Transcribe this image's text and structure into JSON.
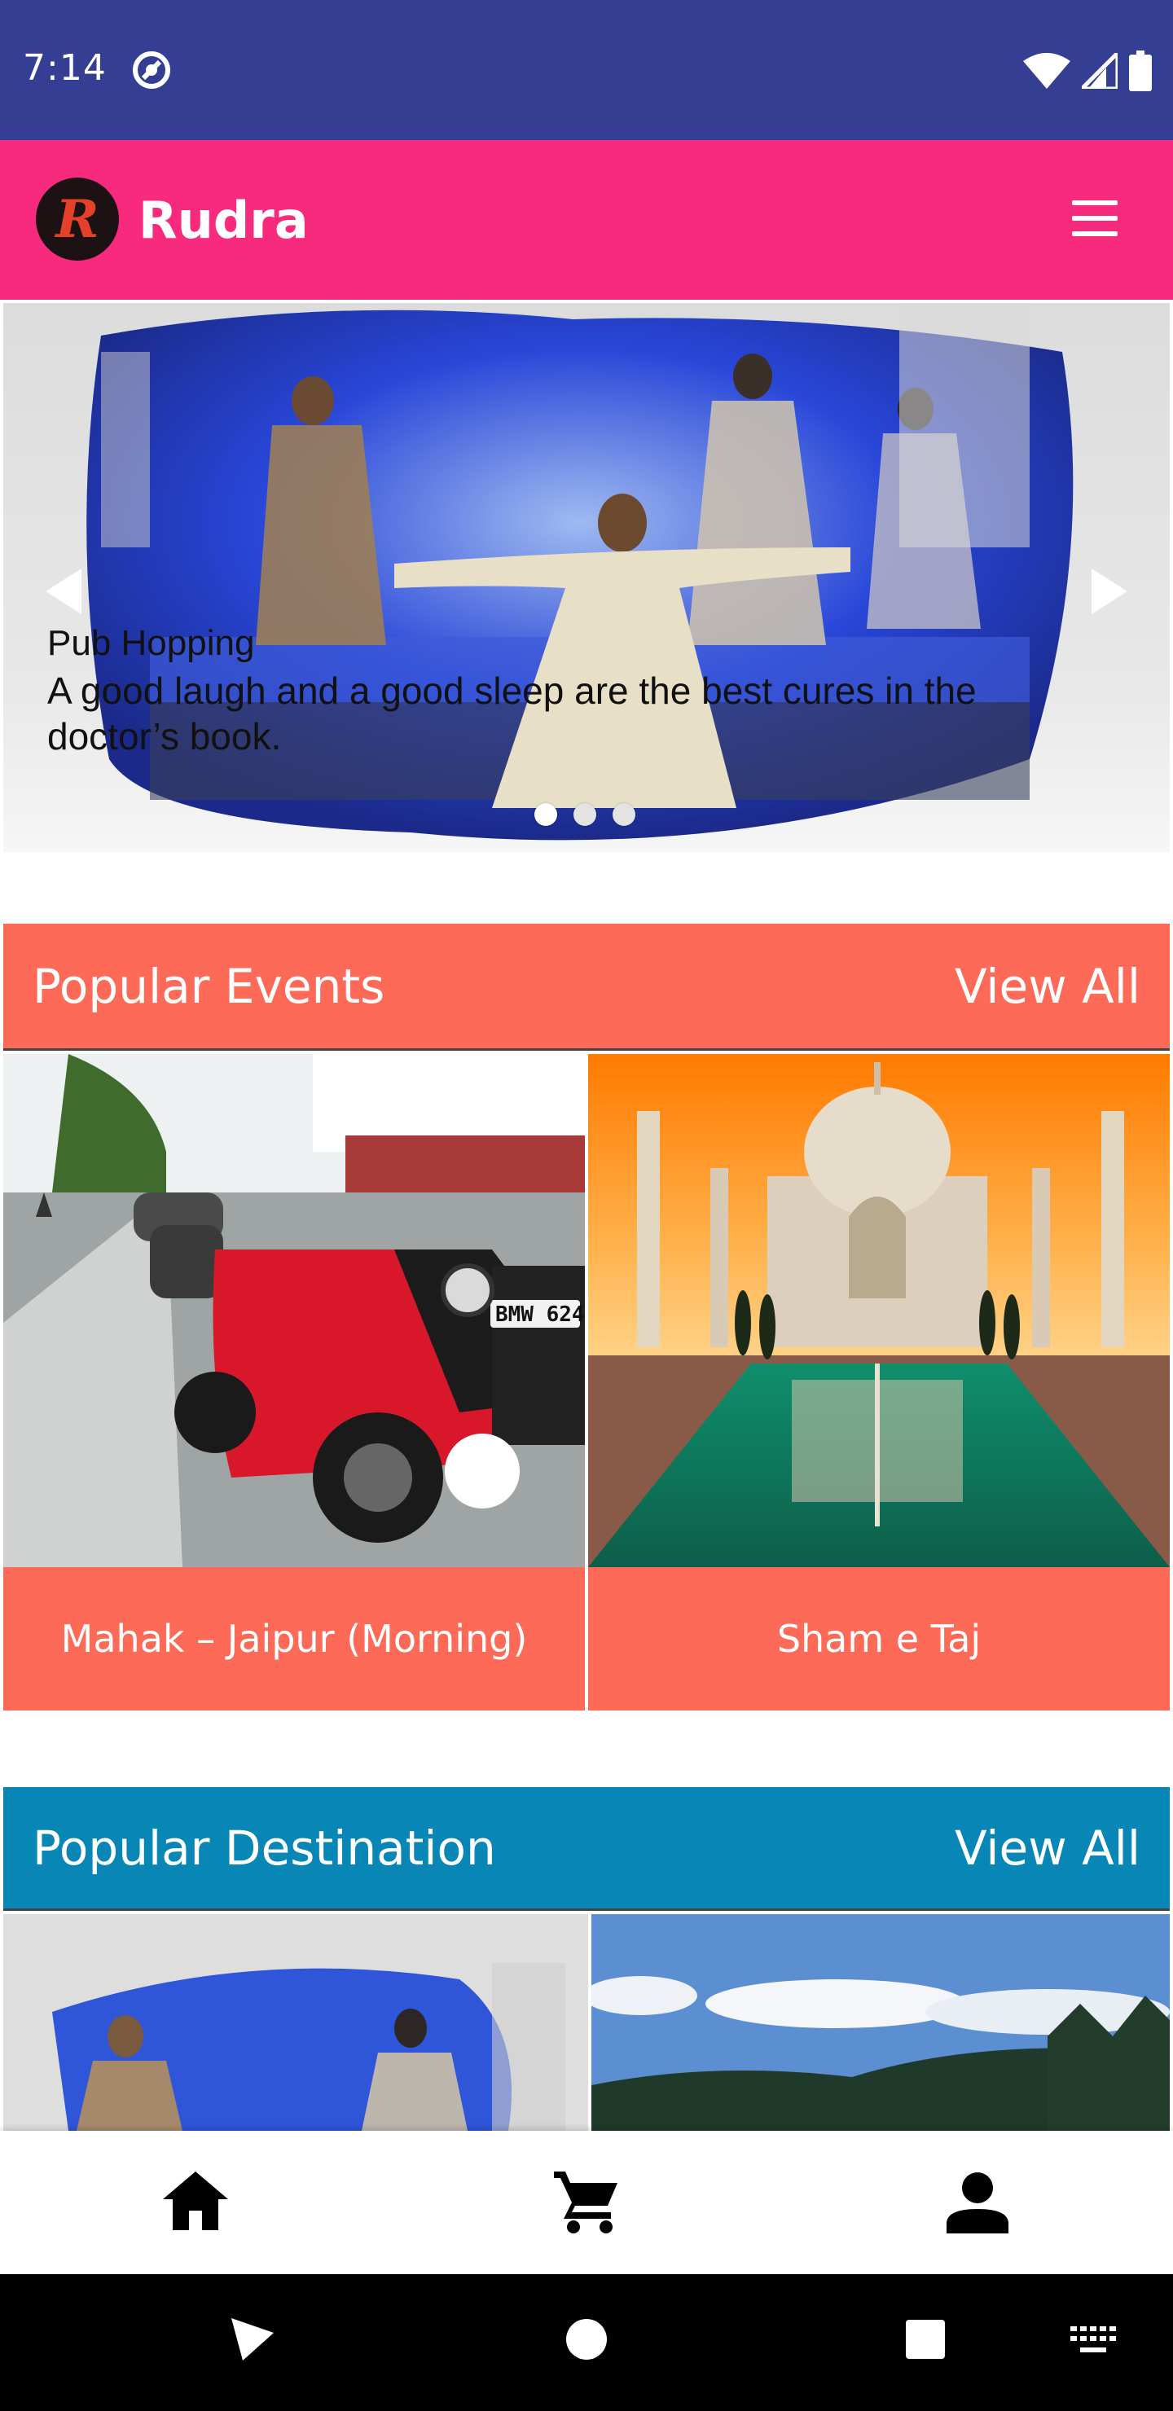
{
  "status_bar": {
    "time": "7:14"
  },
  "app_bar": {
    "title": "Rudra",
    "logo_letter": "R"
  },
  "carousel": {
    "caption_title": "Pub Hopping",
    "caption_text": "A good laugh and a good sleep are the best cures in the doctor’s book.",
    "slide_count": 3,
    "active_slide": 1
  },
  "popular_events": {
    "title": "Popular Events",
    "view_all": "View All",
    "items": [
      {
        "label": "Mahak – Jaipur (Morning)",
        "plate": "BMW 624"
      },
      {
        "label": "Sham e Taj"
      }
    ]
  },
  "popular_destination": {
    "title": "Popular Destination",
    "view_all": "View All"
  },
  "bottom_nav": [
    "home-icon",
    "cart-icon",
    "person-icon"
  ],
  "colors": {
    "status_bar": "#343f93",
    "app_bar": "#f72a7d",
    "events_accent": "#fe6a58",
    "destination_accent": "#0887b6"
  }
}
